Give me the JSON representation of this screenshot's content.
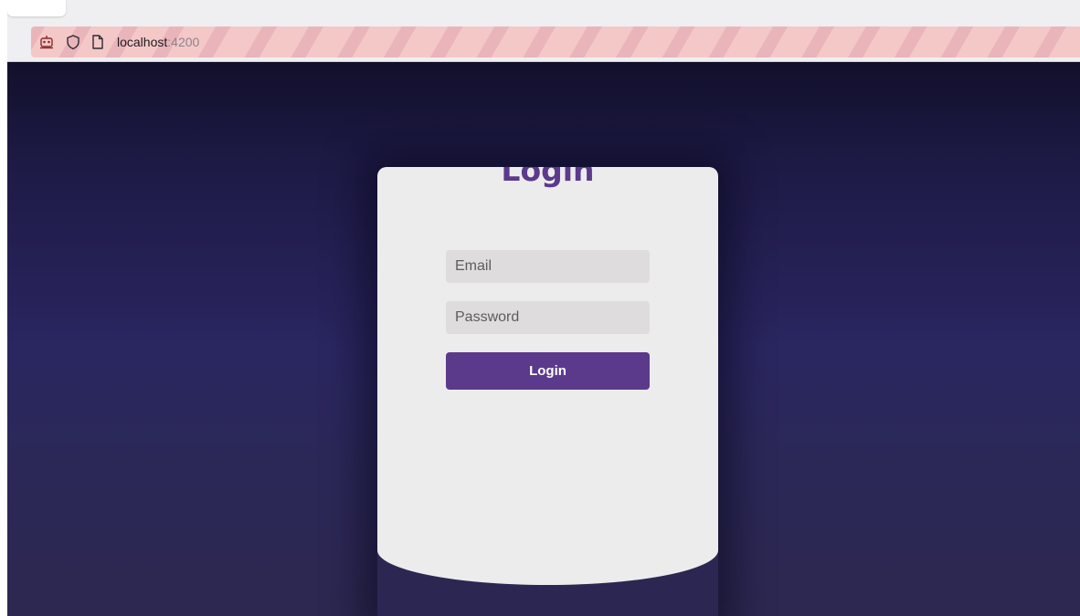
{
  "browser": {
    "url_host": "localhost",
    "url_port": ":4200",
    "icons": [
      "robot-icon",
      "shield-icon",
      "page-icon"
    ]
  },
  "login": {
    "title": "Login",
    "email_placeholder": "Email",
    "password_placeholder": "Password",
    "submit_label": "Login"
  },
  "colors": {
    "accent": "#5b3a8c",
    "card": "#ececec",
    "field": "#dedcdc",
    "background_top": "#11102b",
    "background_mid": "#2a2660"
  }
}
